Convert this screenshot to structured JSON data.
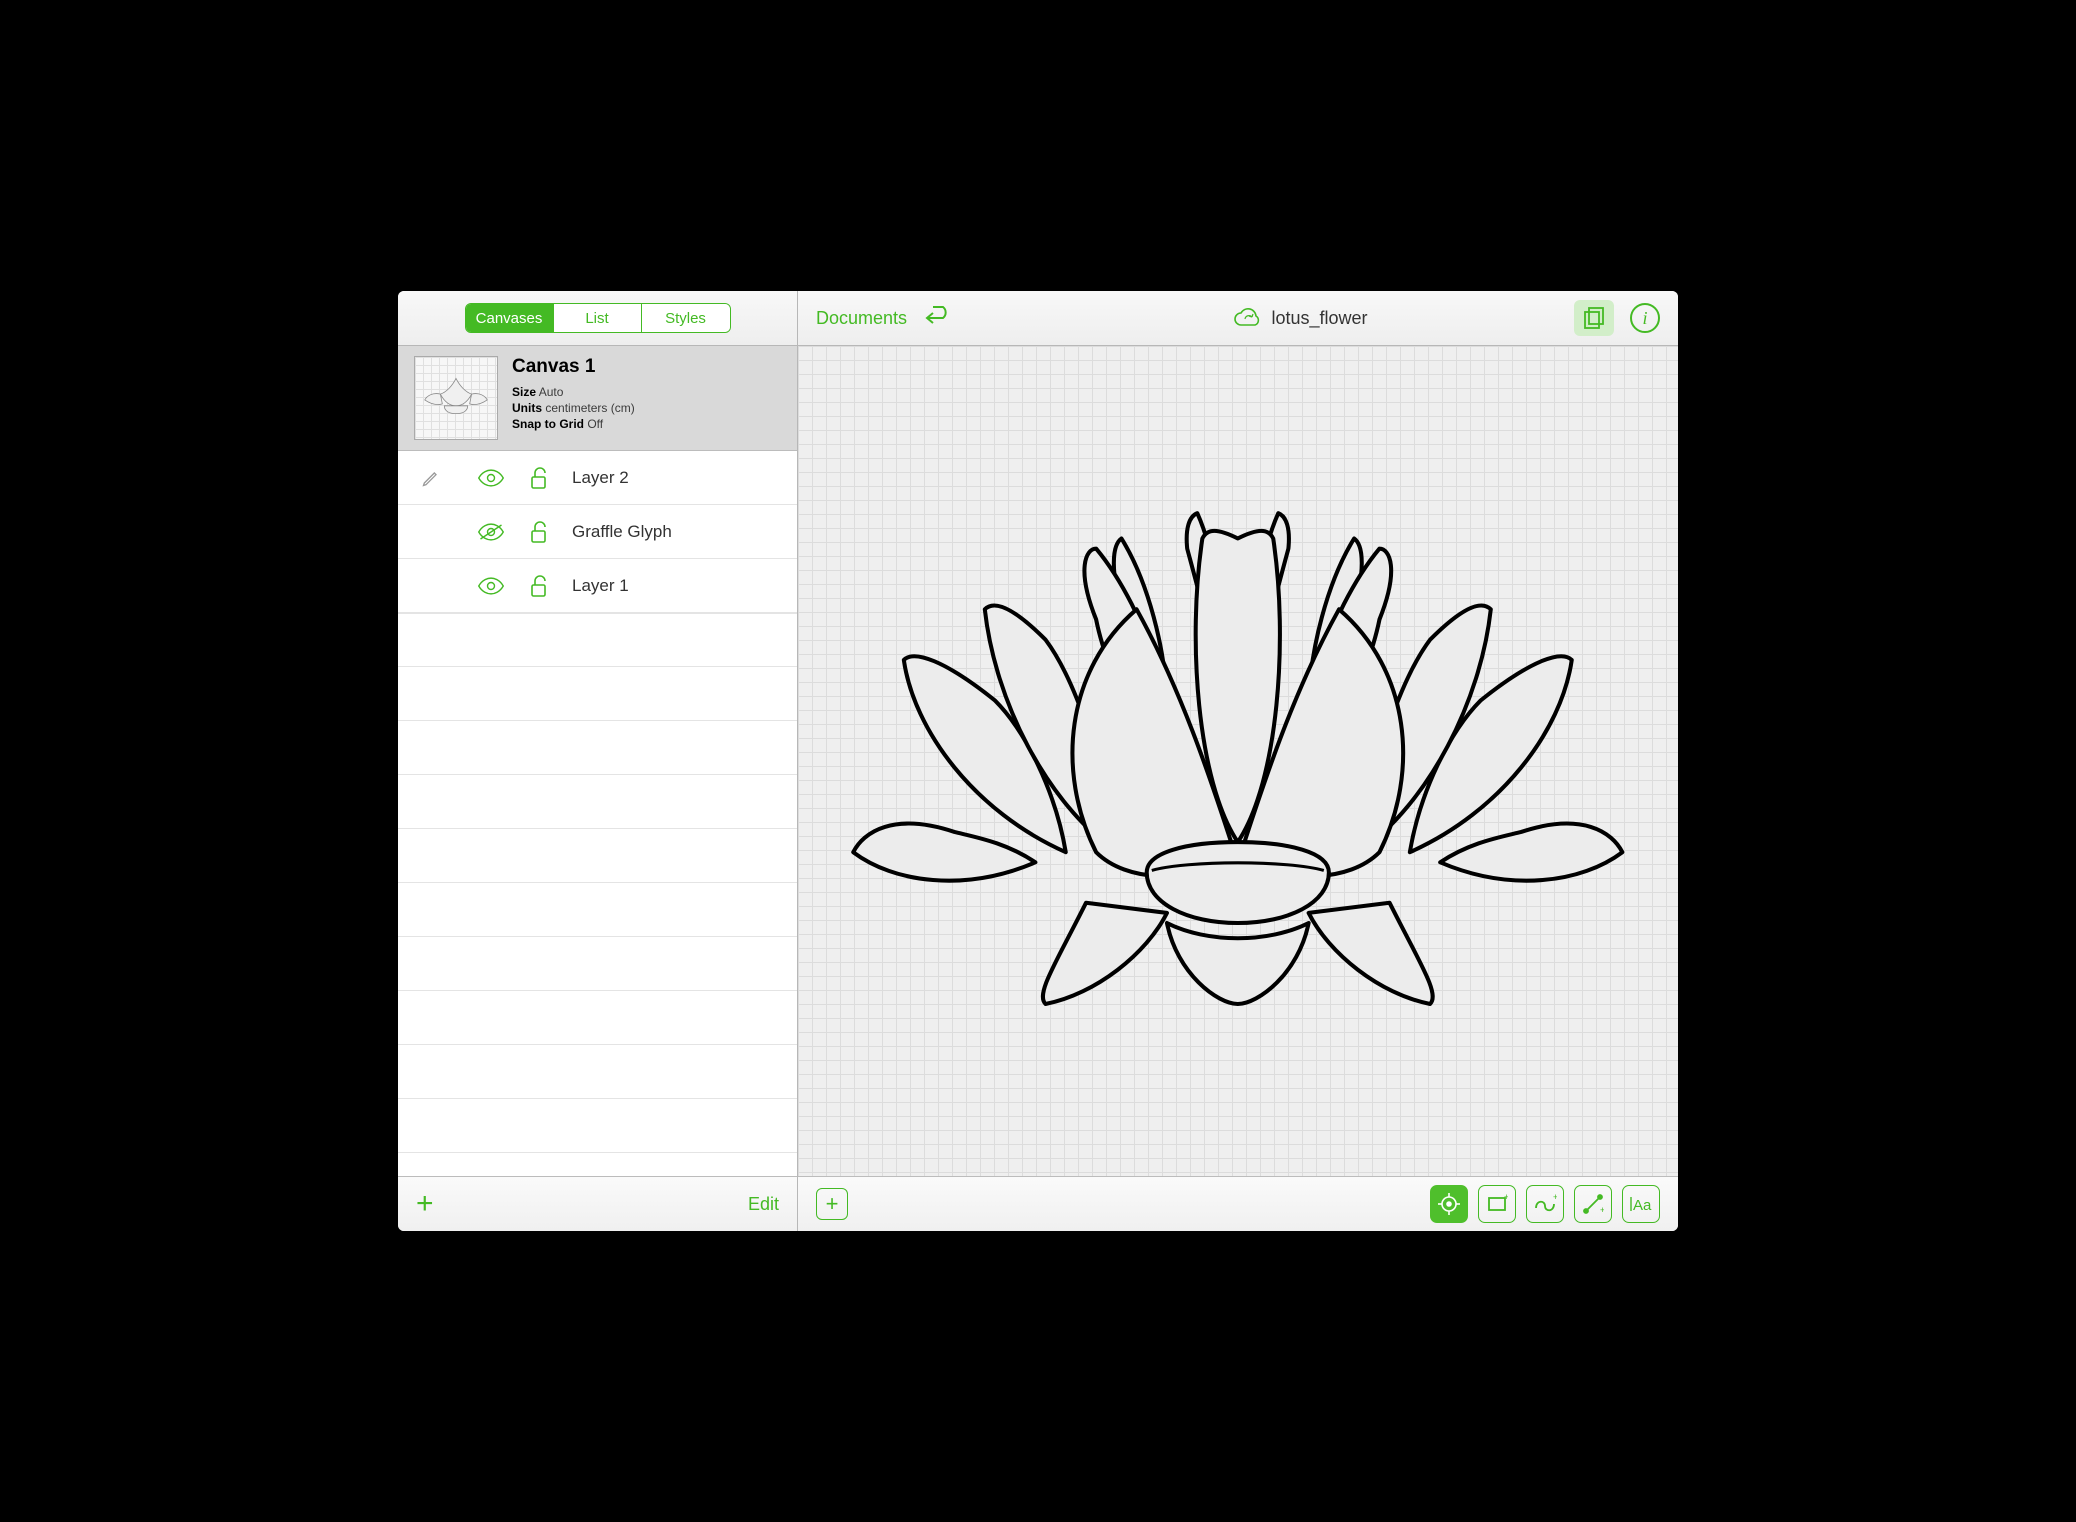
{
  "sidebar": {
    "tabs": {
      "canvases": "Canvases",
      "list": "List",
      "styles": "Styles"
    },
    "active_tab": "canvases",
    "canvas": {
      "title": "Canvas 1",
      "size_label": "Size",
      "size_value": "Auto",
      "units_label": "Units",
      "units_value": "centimeters (cm)",
      "snap_label": "Snap to Grid",
      "snap_value": "Off"
    },
    "layers": [
      {
        "name": "Layer 2",
        "visible": true,
        "locked": false
      },
      {
        "name": "Graffle Glyph",
        "visible": false,
        "locked": false
      },
      {
        "name": "Layer 1",
        "visible": true,
        "locked": false
      }
    ],
    "add_label": "+",
    "edit_label": "Edit"
  },
  "toolbar": {
    "documents_label": "Documents",
    "title": "lotus_flower"
  },
  "bottom_tools": {
    "add_label": "+",
    "select": "select",
    "rect": "rect",
    "freehand": "freehand",
    "line": "line",
    "text": "text"
  },
  "colors": {
    "accent": "#44ba24"
  }
}
